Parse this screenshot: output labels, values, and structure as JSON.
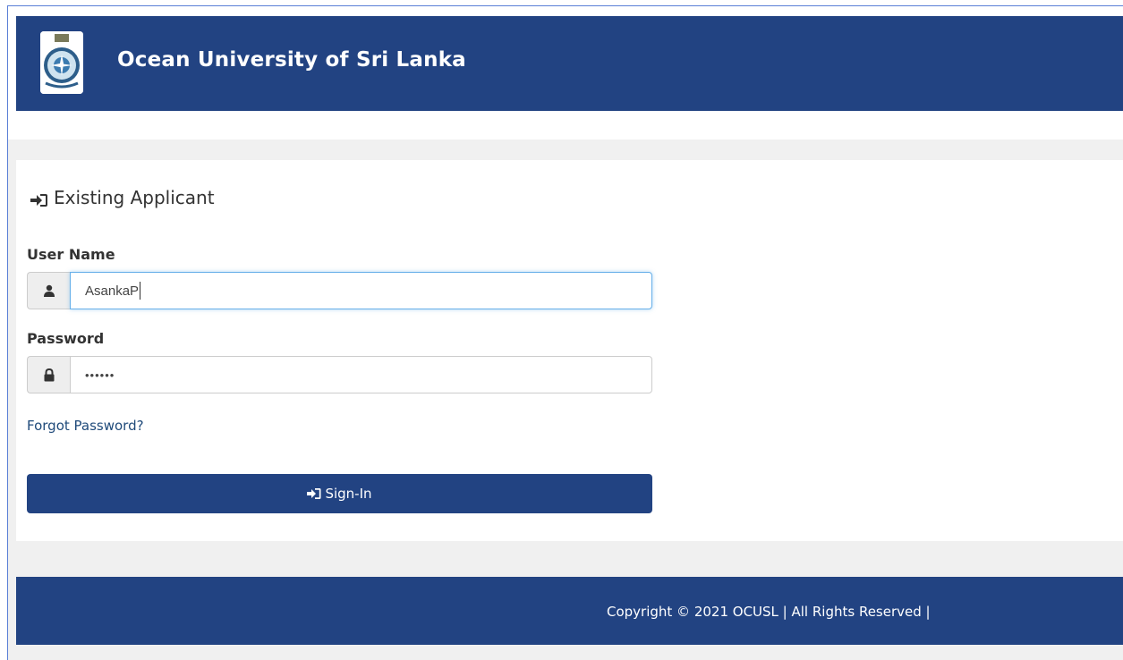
{
  "header": {
    "title": "Ocean University of Sri Lanka",
    "logo_icon": "university-crest-icon"
  },
  "login": {
    "heading": "Existing Applicant",
    "heading_icon": "sign-in-icon",
    "username_label": "User Name",
    "username_value": "AsankaP",
    "username_icon": "user-icon",
    "password_label": "Password",
    "password_value": "••••••",
    "password_icon": "lock-icon",
    "forgot_link": "Forgot Password?",
    "signin_label": "Sign-In",
    "signin_icon": "sign-in-icon"
  },
  "footer": {
    "copyright": "Copyright © 2021 OCUSL | All Rights Reserved |"
  },
  "colors": {
    "brand": "#224382",
    "background": "#f0f0f0",
    "focus": "#66afe9",
    "link": "#1f4a7a"
  }
}
